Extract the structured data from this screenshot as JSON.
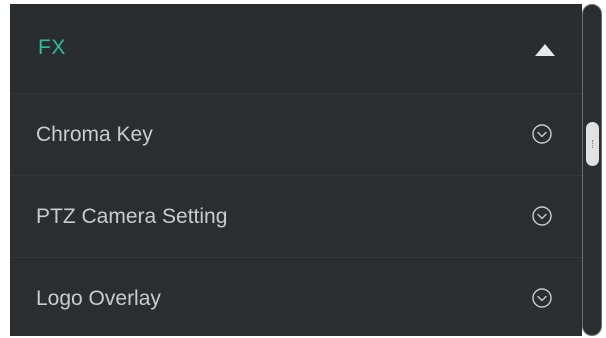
{
  "header": {
    "title": "FX",
    "toggle_icon": "triangle-up-icon"
  },
  "items": [
    {
      "label": "Chroma Key",
      "icon": "chevron-circle-down-icon"
    },
    {
      "label": "PTZ Camera Setting",
      "icon": "chevron-circle-down-icon"
    },
    {
      "label": "Logo Overlay",
      "icon": "chevron-circle-down-icon"
    }
  ],
  "colors": {
    "accent": "#2bbd9b",
    "panel_bg": "#2b2e31",
    "text": "#c9cbcd",
    "icon": "#c9cbcd",
    "scroll_thumb": "#dfe1e3"
  },
  "scrollbar": {
    "position_fraction": 0.3
  }
}
